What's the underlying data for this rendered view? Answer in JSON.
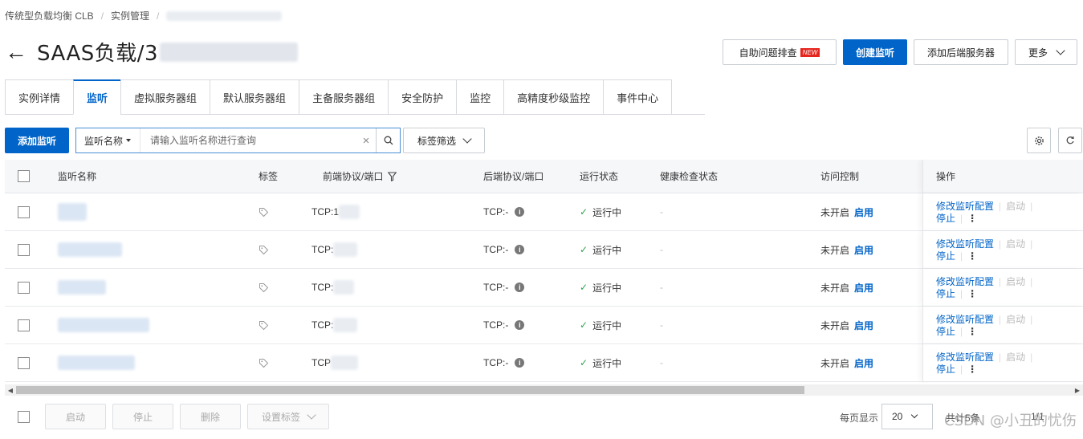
{
  "breadcrumb": {
    "items": [
      "传统型负载均衡 CLB",
      "实例管理"
    ]
  },
  "header": {
    "title": "SAAS负载/3",
    "back_arrow": "←"
  },
  "actions": {
    "diagnose": "自助问题排查",
    "new_badge": "NEW",
    "create_listener": "创建监听",
    "add_backend": "添加后端服务器",
    "more": "更多"
  },
  "tabs": [
    {
      "label": "实例详情"
    },
    {
      "label": "监听"
    },
    {
      "label": "虚拟服务器组"
    },
    {
      "label": "默认服务器组"
    },
    {
      "label": "主备服务器组"
    },
    {
      "label": "安全防护"
    },
    {
      "label": "监控"
    },
    {
      "label": "高精度秒级监控"
    },
    {
      "label": "事件中心"
    }
  ],
  "toolbar": {
    "add_listener": "添加监听",
    "search_field": "监听名称",
    "search_placeholder": "请输入监听名称进行查询",
    "tag_filter": "标签筛选"
  },
  "table": {
    "headers": {
      "name": "监听名称",
      "tag": "标签",
      "frontend": "前端协议/端口",
      "backend": "后端协议/端口",
      "status": "运行状态",
      "health": "健康检查状态",
      "acl": "访问控制",
      "ops": "操作"
    },
    "rows": [
      {
        "frontend": "TCP:1",
        "backend": "TCP:-",
        "status": "运行中",
        "health": "-",
        "acl": "未开启",
        "acl_action": "启用",
        "op_edit": "修改监听配置",
        "op_start": "启动",
        "op_stop": "停止"
      },
      {
        "frontend": "TCP:",
        "backend": "TCP:-",
        "status": "运行中",
        "health": "-",
        "acl": "未开启",
        "acl_action": "启用",
        "op_edit": "修改监听配置",
        "op_start": "启动",
        "op_stop": "停止"
      },
      {
        "frontend": "TCP:",
        "backend": "TCP:-",
        "status": "运行中",
        "health": "-",
        "acl": "未开启",
        "acl_action": "启用",
        "op_edit": "修改监听配置",
        "op_start": "启动",
        "op_stop": "停止"
      },
      {
        "frontend": "TCP:",
        "backend": "TCP:-",
        "status": "运行中",
        "health": "-",
        "acl": "未开启",
        "acl_action": "启用",
        "op_edit": "修改监听配置",
        "op_start": "启动",
        "op_stop": "停止"
      },
      {
        "frontend": "TCP",
        "backend": "TCP:-",
        "status": "运行中",
        "health": "-",
        "acl": "未开启",
        "acl_action": "启用",
        "op_edit": "修改监听配置",
        "op_start": "启动",
        "op_stop": "停止"
      }
    ]
  },
  "footer": {
    "start": "启动",
    "stop": "停止",
    "delete": "删除",
    "set_tags": "设置标签",
    "page_size_label": "每页显示",
    "page_size": "20",
    "total": "共计5条",
    "pager": "1/1"
  },
  "watermark": "CSDN @小丑的忧伤",
  "colors": {
    "primary": "#0064c8",
    "new_badge": "#e5261f",
    "running": "#2ea44f"
  }
}
